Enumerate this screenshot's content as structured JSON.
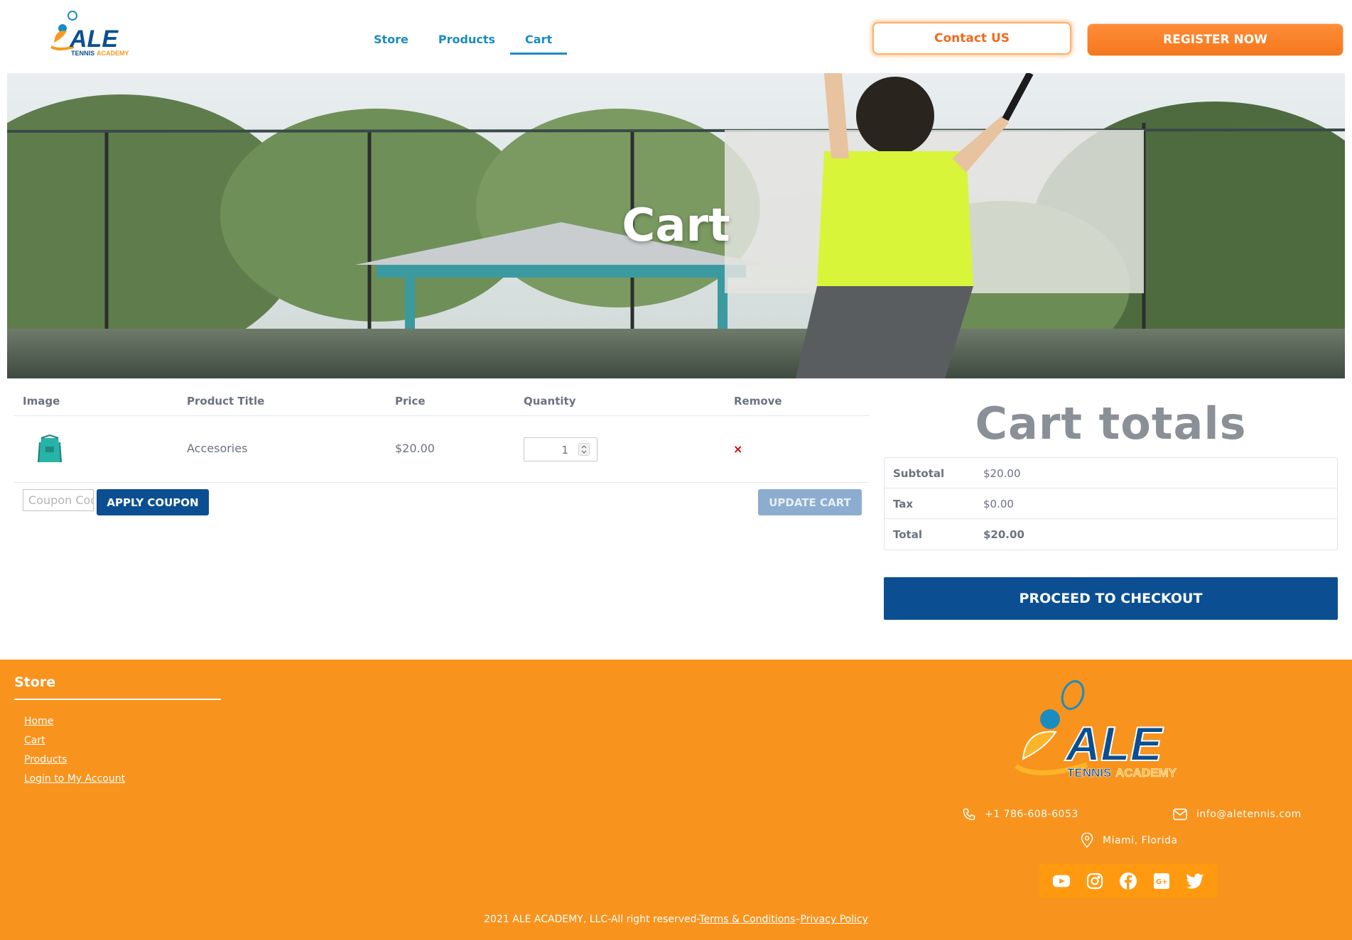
{
  "header": {
    "logo_main": "ALE",
    "logo_sub_1": "TENNIS",
    "logo_sub_2": "ACADEMY",
    "nav": [
      {
        "label": "Store"
      },
      {
        "label": "Products"
      },
      {
        "label": "Cart",
        "active": true
      }
    ],
    "contact_label": "Contact US",
    "register_label": "REGISTER NOW"
  },
  "hero": {
    "title": "Cart"
  },
  "cart": {
    "columns": [
      "Image",
      "Product Title",
      "Price",
      "Quantity",
      "Remove"
    ],
    "rows": [
      {
        "title": "Accesories",
        "price": "$20.00",
        "quantity": "1",
        "remove": "×",
        "image_icon": "backpack-icon"
      }
    ],
    "coupon_placeholder": "Coupon Code",
    "apply_coupon_label": "APPLY COUPON",
    "update_cart_label": "UPDATE CART"
  },
  "totals": {
    "title": "Cart totals",
    "rows": [
      {
        "label": "Subtotal",
        "value": "$20.00"
      },
      {
        "label": "Tax",
        "value": "$0.00"
      },
      {
        "label": "Total",
        "value": "$20.00"
      }
    ],
    "checkout_label": "PROCEED TO CHECKOUT"
  },
  "footer": {
    "heading": "Store",
    "links": [
      "Home",
      "Cart",
      "Products",
      "Login to My Account"
    ],
    "phone": "+1 786-608-6053",
    "email": "info@aletennis.com",
    "location": "Miami, Florida",
    "social_icons": [
      "youtube-icon",
      "instagram-icon",
      "facebook-icon",
      "google-plus-icon",
      "twitter-icon"
    ],
    "copyright_text": "2021 ALE ACADEMY, LLC-All right reserved-",
    "terms_label": "Terms & Conditions",
    "separator": "–",
    "privacy_label": "Privacy Policy"
  },
  "colors": {
    "brand_blue": "#0b4f92",
    "nav_blue": "#1a8dc0",
    "brand_orange": "#f8931d",
    "accent_orange": "#f26a1d"
  }
}
